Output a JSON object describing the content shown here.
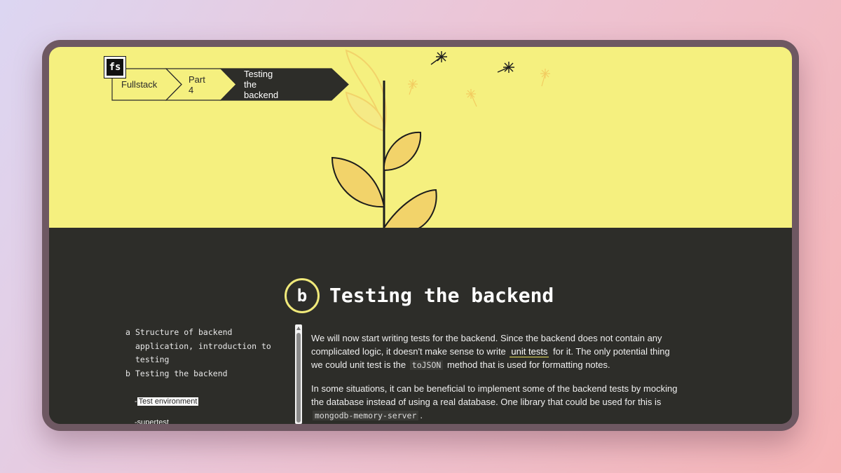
{
  "logo": {
    "text": "fs"
  },
  "breadcrumb": {
    "items": [
      {
        "label": "Fullstack"
      },
      {
        "label": "Part 4"
      },
      {
        "label": "Testing the backend"
      }
    ]
  },
  "section": {
    "letter": "b",
    "title": "Testing the backend"
  },
  "toc": {
    "items": [
      {
        "letter": "a",
        "label": "Structure of backend application, introduction to testing"
      },
      {
        "letter": "b",
        "label": "Testing the backend"
      }
    ],
    "subitems": [
      {
        "label": "Test environment",
        "active": true
      },
      {
        "label": "supertest",
        "active": false
      }
    ],
    "dash": "-"
  },
  "article": {
    "p1": {
      "before": "We will now start writing tests for the backend. Since the backend does not contain any complicated logic, it doesn't make sense to write",
      "link": "unit tests",
      "middle": "for it. The only potential thing we could unit test is the",
      "code": "toJSON",
      "after": "method that is used for formatting notes."
    },
    "p2": {
      "before": "In some situations, it can be beneficial to implement some of the backend tests by mocking the database instead of using a real database. One library that could be used for this is",
      "code": "mongodb-memory-server",
      "after": "."
    }
  },
  "colors": {
    "hero": "#f5f07f",
    "dark": "#2d2d29",
    "accent": "#f0e97a"
  }
}
